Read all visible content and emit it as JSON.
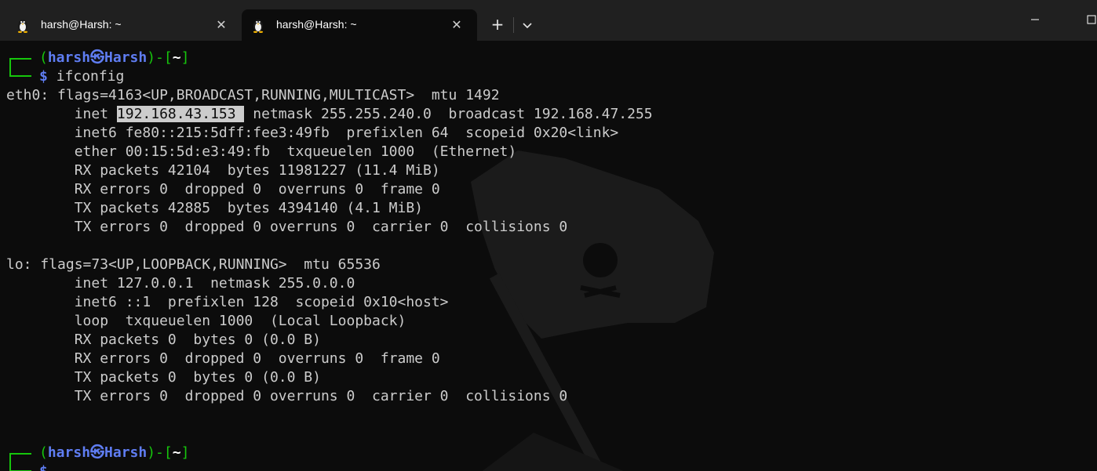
{
  "tabs": [
    {
      "title": "harsh@Harsh: ~"
    },
    {
      "title": "harsh@Harsh: ~"
    }
  ],
  "prompt": {
    "user": "harsh",
    "sep": "㉿",
    "host": "Harsh",
    "dir": "~",
    "dollar": "$"
  },
  "command": "ifconfig",
  "eth0": {
    "line1": "eth0: flags=4163<UP,BROADCAST,RUNNING,MULTICAST>  mtu 1492",
    "inet_pre": "        inet ",
    "inet_ip": "192.168.43.153 ",
    "inet_post": " netmask 255.255.240.0  broadcast 192.168.47.255",
    "inet6": "        inet6 fe80::215:5dff:fee3:49fb  prefixlen 64  scopeid 0x20<link>",
    "ether": "        ether 00:15:5d:e3:49:fb  txqueuelen 1000  (Ethernet)",
    "rx_packets": "        RX packets 42104  bytes 11981227 (11.4 MiB)",
    "rx_errors": "        RX errors 0  dropped 0  overruns 0  frame 0",
    "tx_packets": "        TX packets 42885  bytes 4394140 (4.1 MiB)",
    "tx_errors": "        TX errors 0  dropped 0 overruns 0  carrier 0  collisions 0"
  },
  "lo": {
    "line1": "lo: flags=73<UP,LOOPBACK,RUNNING>  mtu 65536",
    "inet": "        inet 127.0.0.1  netmask 255.0.0.0",
    "inet6": "        inet6 ::1  prefixlen 128  scopeid 0x10<host>",
    "loop": "        loop  txqueuelen 1000  (Local Loopback)",
    "rx_packets": "        RX packets 0  bytes 0 (0.0 B)",
    "rx_errors": "        RX errors 0  dropped 0  overruns 0  frame 0",
    "tx_packets": "        TX packets 0  bytes 0 (0.0 B)",
    "tx_errors": "        TX errors 0  dropped 0 overruns 0  carrier 0  collisions 0"
  },
  "colors": {
    "prompt_green": "#16c60c",
    "prompt_blue": "#5f7df2",
    "text": "#cccccc",
    "background": "#0c0c0c"
  },
  "icons": {
    "tab": "linux-tux-icon",
    "close": "close-icon",
    "new_tab": "plus-icon",
    "dropdown": "chevron-down-icon",
    "minimize": "minimize-icon",
    "maximize": "maximize-icon"
  }
}
